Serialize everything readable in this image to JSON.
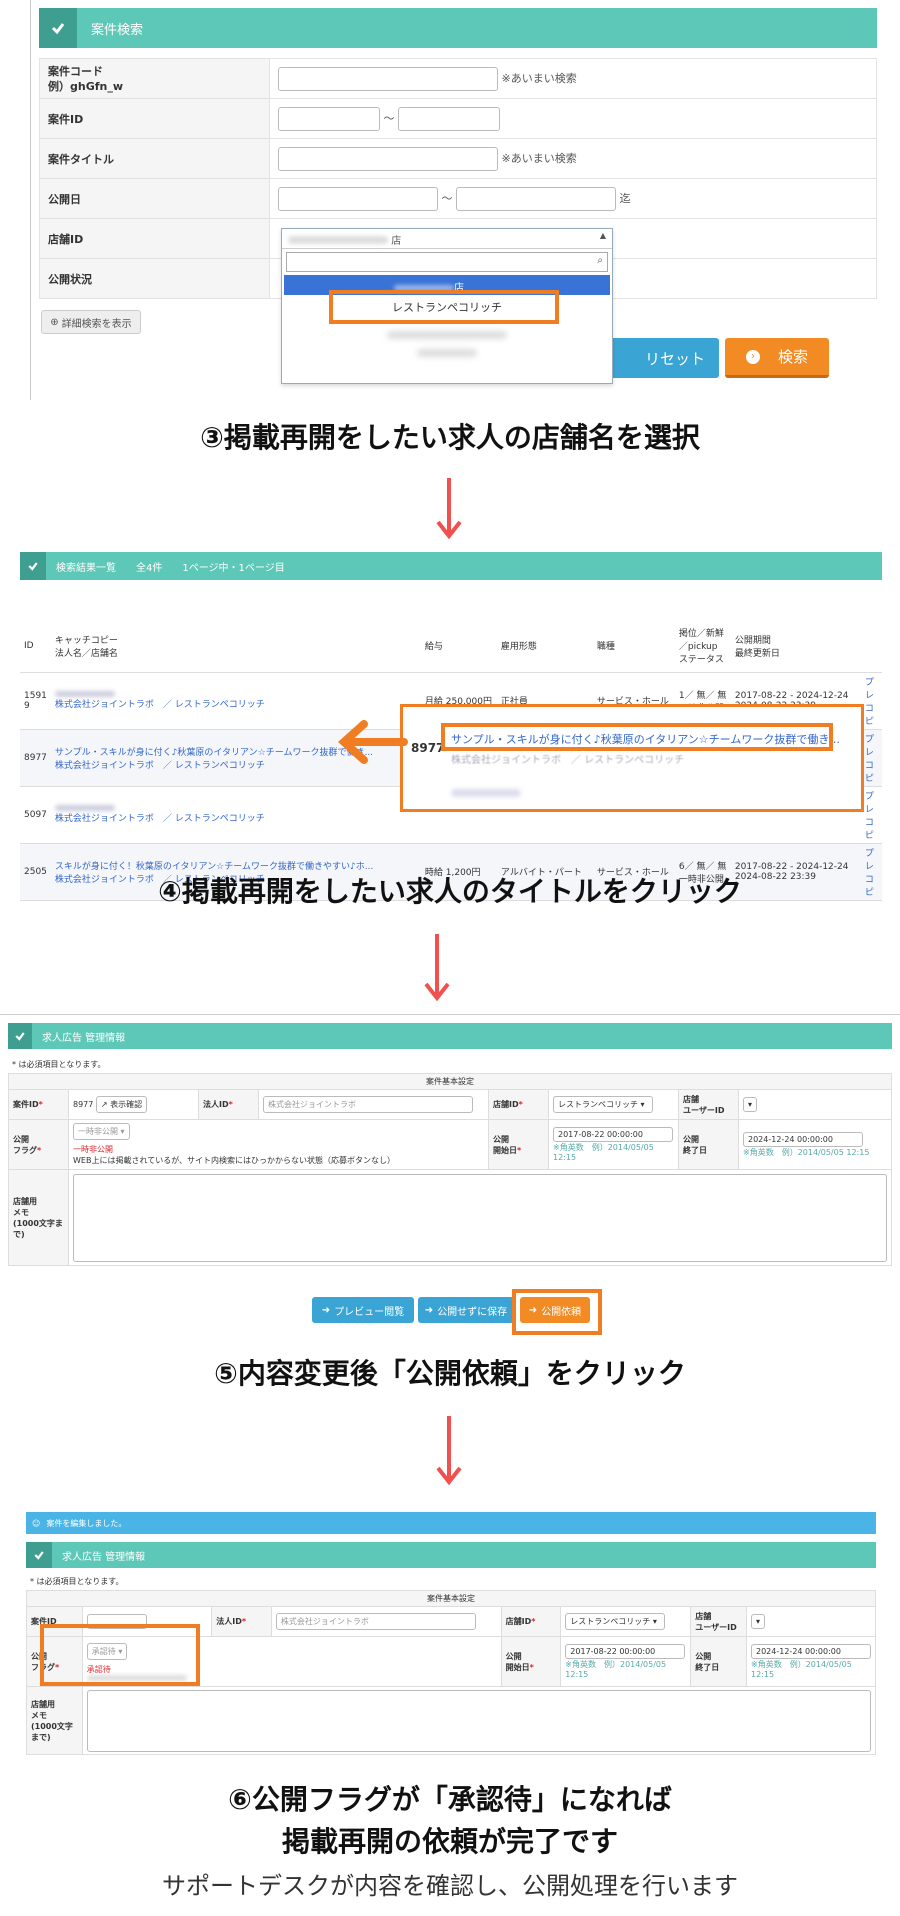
{
  "colors": {
    "accent": "#5ec8b8",
    "orange": "#f07d22",
    "blue": "#3aa5d5",
    "arrow": "#f0504e"
  },
  "section1": {
    "header": "案件検索",
    "rows": [
      {
        "label": "案件コード\n例）ghGfn_w",
        "note": "※あいまい検索"
      },
      {
        "label": "案件ID",
        "sep": "〜"
      },
      {
        "label": "案件タイトル",
        "note": "※あいまい検索"
      },
      {
        "label": "公開日",
        "sep": "〜",
        "suffix": "迄"
      },
      {
        "label": "店舗ID"
      },
      {
        "label": "公開状況"
      }
    ],
    "store_selected": "店",
    "dropdown_highlight": "店",
    "dropdown_option": "レストランペコリッチ",
    "detail_button": "詳細検索を表示",
    "reset_button": "リセット",
    "search_button": "検索"
  },
  "step3": "③掲載再開をしたい求人の店舗名を選択",
  "section2": {
    "header": "検索結果一覧",
    "total": "全4件",
    "page_info": "1ページ中・1ページ目",
    "columns": [
      "ID",
      "キャッチコピー\n法人名／店舗名",
      "給与",
      "雇用形態",
      "職種",
      "掲位／新鮮\n／pickup\nステータス",
      "公開期間\n最終更新日"
    ],
    "rows": [
      {
        "id": "1591\n9",
        "title": "",
        "company": "株式会社ジョイントラボ　／ レストランペコリッチ",
        "salary": "月給 250,000円",
        "type": "正社員",
        "job": "サービス・ホール",
        "status": "1／ 無／ 無\n一時非公開",
        "period": "2017-08-22 - 2024-12-24\n2024-08-22 23:39",
        "more": "プレ\nコピ"
      },
      {
        "id": "8977",
        "title": "サンプル・スキルが身に付く♪秋葉原のイタリアン☆チームワーク抜群で働き...",
        "company": "株式会社ジョイントラボ　／ レストランペコリッチ",
        "salary": "",
        "type": "",
        "job": "",
        "status": "",
        "period": "",
        "more": "プレ\nコピ"
      },
      {
        "id": "5097",
        "title": "",
        "company": "株式会社ジョイントラボ　／ レストランペコリッチ",
        "salary": "",
        "type": "",
        "job": "",
        "status": "",
        "period": "",
        "more": "プレ\nコピ"
      },
      {
        "id": "2505",
        "title": "スキルが身に付く！秋葉原のイタリアン☆チームワーク抜群で働きやすい♪ホ...",
        "company": "株式会社ジョイントラボ　／ レストランペコリッチ",
        "salary": "時給 1,200円",
        "type": "アルバイト・パート",
        "job": "サービス・ホール",
        "status": "6／ 無／ 無\n一時非公開",
        "period": "2017-08-22 - 2024-12-24\n2024-08-22 23:39",
        "more": "プレ\nコピ"
      }
    ],
    "zoom_id": "8977",
    "zoom_title": "サンプル・スキルが身に付く♪秋葉原のイタリアン☆チームワーク抜群で働き...",
    "zoom_company": "株式会社ジョイントラボ　／ レストランペコリッチ"
  },
  "step4": "④掲載再開をしたい求人のタイトルをクリック",
  "section3": {
    "header": "求人広告 管理情報",
    "required_note": "* は必須項目となります。",
    "table_title": "案件基本設定",
    "case_id_label": "案件ID",
    "case_id": "8977",
    "display_check": "表示確認",
    "corp_id_label": "法人ID",
    "corp_value": "株式会社ジョイントラボ",
    "store_id_label": "店舗ID",
    "store_value": "レストランペコリッチ",
    "store_user_label": "店舗\nユーザーID",
    "flag_label": "公開\nフラグ",
    "flag_value": "一時非公開",
    "flag_status": "一時非公開",
    "flag_desc": "WEB上には掲載されているが、サイト内検索にはひっかからない状態（応募ボタンなし）",
    "start_label": "公開\n開始日",
    "start_value": "2017-08-22 00:00:00",
    "date_hint": "※角英数　例）2014/05/05 12:15",
    "end_label": "公開\n終了日",
    "end_value": "2024-12-24 00:00:00",
    "memo_label": "店舗用\nメモ\n(1000文字まで)",
    "preview_btn": "プレビュー閲覧",
    "save_btn": "公開せずに保存",
    "publish_btn": "公開依頼"
  },
  "step5": "⑤内容変更後「公開依頼」をクリック",
  "section4": {
    "success_msg": "案件を編集しました。",
    "header": "求人広告 管理情報",
    "required_note": "* は必須項目となります。",
    "table_title": "案件基本設定",
    "case_id_label": "案件ID",
    "corp_id_label": "法人ID",
    "corp_value": "株式会社ジョイントラボ",
    "store_id_label": "店舗ID",
    "store_value": "レストランペコリッチ",
    "store_user_label": "店舗\nユーザーID",
    "flag_label": "公開\nフラグ",
    "flag_value": "承認待",
    "flag_status": "承認待",
    "start_label": "公開\n開始日",
    "start_value": "2017-08-22 00:00:00",
    "date_hint": "※角英数　例）2014/05/05 12:15",
    "end_label": "公開\n終了日",
    "end_value": "2024-12-24 00:00:00",
    "memo_label": "店舗用\nメモ\n(1000文字まで)"
  },
  "step6_line1": "⑥公開フラグが「承認待」になれば",
  "step6_line2": "掲載再開の依頼が完了です",
  "step6_line3": "サポートデスクが内容を確認し、公開処理を行います"
}
